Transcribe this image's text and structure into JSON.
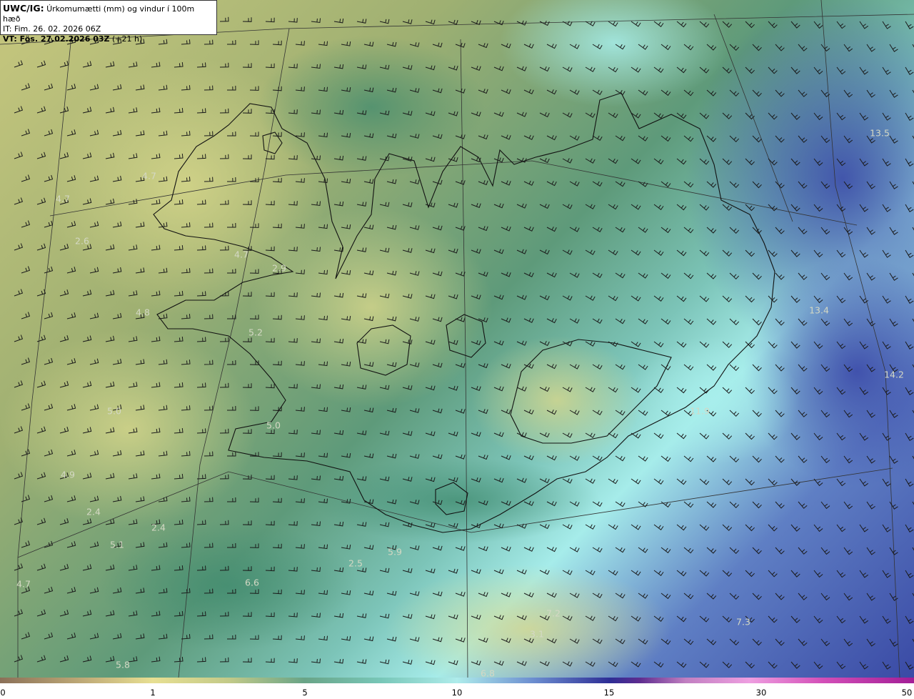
{
  "header": {
    "title_prefix": "UWC/IG:",
    "title_text": " Úrkomumætti (mm) og vindur í 100m hæð",
    "init_line": "IT: Fim. 26. 02. 2026 06Z",
    "valid_prefix": "VT: Fös. 27.02.2026 03Z",
    "valid_suffix": " (+21 h)"
  },
  "map_values": [
    {
      "text": "13.5"
    },
    {
      "text": "4.7"
    },
    {
      "text": "4.7"
    },
    {
      "text": "2.6"
    },
    {
      "text": "4.7"
    },
    {
      "text": "2.9"
    },
    {
      "text": "4.8"
    },
    {
      "text": "5.2"
    },
    {
      "text": "13.4"
    },
    {
      "text": "14.2"
    },
    {
      "text": "11.9"
    },
    {
      "text": "5.0"
    },
    {
      "text": "5.0"
    },
    {
      "text": "4.9"
    },
    {
      "text": "2.4"
    },
    {
      "text": "2.4"
    },
    {
      "text": "5.1"
    },
    {
      "text": "5.9"
    },
    {
      "text": "2.5"
    },
    {
      "text": "4.7"
    },
    {
      "text": "6.6"
    },
    {
      "text": "7.2"
    },
    {
      "text": "7.3"
    },
    {
      "text": "3.1"
    },
    {
      "text": "5.8"
    },
    {
      "text": "6.8"
    }
  ],
  "colorbar": {
    "ticks": [
      "0",
      "1",
      "5",
      "10",
      "15",
      "30",
      "50"
    ],
    "colors": [
      "#8b7058",
      "#e7df92",
      "#69a487",
      "#aeeceb",
      "#2d2d95",
      "#c17fc1",
      "#a21d96"
    ]
  }
}
